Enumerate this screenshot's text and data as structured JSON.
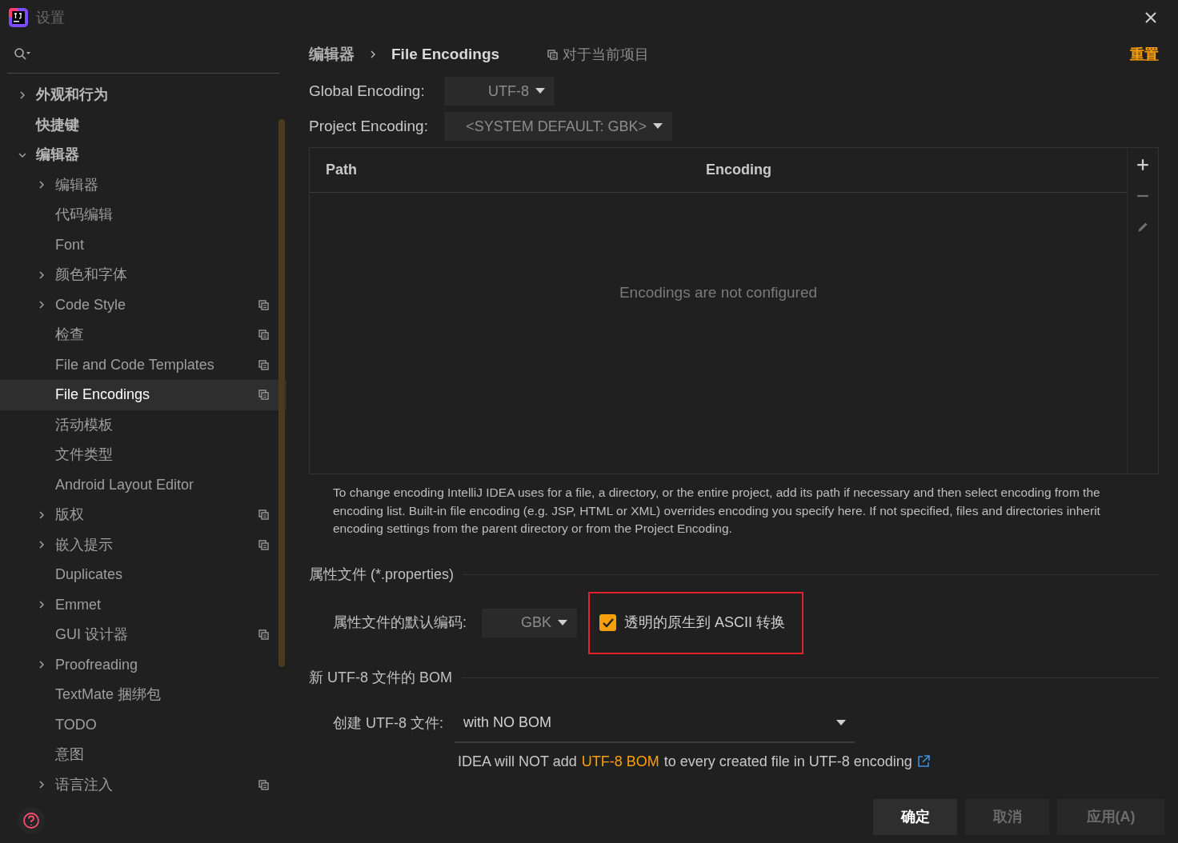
{
  "window": {
    "title": "设置"
  },
  "tree": [
    {
      "label": "外观和行为",
      "kind": "folder",
      "expanded": false,
      "selected": false,
      "project": false
    },
    {
      "label": "快捷键",
      "kind": "leaf",
      "selected": false,
      "project": false
    },
    {
      "label": "编辑器",
      "kind": "folder",
      "expanded": true,
      "selected": false,
      "project": false,
      "children": [
        {
          "label": "编辑器",
          "kind": "folder",
          "expanded": false,
          "selected": false,
          "project": false
        },
        {
          "label": "代码编辑",
          "kind": "leaf",
          "selected": false,
          "project": false
        },
        {
          "label": "Font",
          "kind": "leaf",
          "selected": false,
          "project": false
        },
        {
          "label": "颜色和字体",
          "kind": "folder",
          "expanded": false,
          "selected": false,
          "project": false
        },
        {
          "label": "Code Style",
          "kind": "folder",
          "expanded": false,
          "selected": false,
          "project": true
        },
        {
          "label": "检查",
          "kind": "leaf",
          "selected": false,
          "project": true
        },
        {
          "label": "File and Code Templates",
          "kind": "leaf",
          "selected": false,
          "project": true
        },
        {
          "label": "File Encodings",
          "kind": "leaf",
          "selected": true,
          "project": true
        },
        {
          "label": "活动模板",
          "kind": "leaf",
          "selected": false,
          "project": false
        },
        {
          "label": "文件类型",
          "kind": "leaf",
          "selected": false,
          "project": false
        },
        {
          "label": "Android Layout Editor",
          "kind": "leaf",
          "selected": false,
          "project": false
        },
        {
          "label": "版权",
          "kind": "folder",
          "expanded": false,
          "selected": false,
          "project": true
        },
        {
          "label": "嵌入提示",
          "kind": "folder",
          "expanded": false,
          "selected": false,
          "project": true
        },
        {
          "label": "Duplicates",
          "kind": "leaf",
          "selected": false,
          "project": false
        },
        {
          "label": "Emmet",
          "kind": "folder",
          "expanded": false,
          "selected": false,
          "project": false
        },
        {
          "label": "GUI 设计器",
          "kind": "leaf",
          "selected": false,
          "project": true
        },
        {
          "label": "Proofreading",
          "kind": "folder",
          "expanded": false,
          "selected": false,
          "project": false
        },
        {
          "label": "TextMate 捆绑包",
          "kind": "leaf",
          "selected": false,
          "project": false
        },
        {
          "label": "TODO",
          "kind": "leaf",
          "selected": false,
          "project": false
        },
        {
          "label": "意图",
          "kind": "leaf",
          "selected": false,
          "project": false
        },
        {
          "label": "语言注入",
          "kind": "folder",
          "expanded": false,
          "selected": false,
          "project": true
        }
      ]
    }
  ],
  "breadcrumb": [
    "编辑器",
    "File Encodings"
  ],
  "scope": "对于当前项目",
  "reset": "重置",
  "encodings": [
    {
      "label": "Global Encoding:",
      "value": "UTF-8"
    },
    {
      "label": "Project Encoding:",
      "value": "<SYSTEM DEFAULT: GBK>"
    }
  ],
  "table": {
    "columns": [
      "Path",
      "Encoding"
    ],
    "empty_text": "Encodings are not configured",
    "tools": [
      {
        "kind": "add",
        "disabled": false
      },
      {
        "kind": "remove",
        "disabled": true
      },
      {
        "kind": "edit",
        "disabled": true
      }
    ]
  },
  "description": "To change encoding IntelliJ IDEA uses for a file, a directory, or the entire project, add its path if necessary and then select encoding from the encoding list. Built-in file encoding (e.g. JSP, HTML or XML) overrides encoding you specify here. If not specified, files and directories inherit encoding settings from the parent directory or from the Project Encoding.",
  "properties": {
    "title": "属性文件 (*.properties)",
    "label": "属性文件的默认编码:",
    "value": "GBK",
    "checkbox": {
      "label": "透明的原生到 ASCII 转换",
      "checked": true,
      "highlighted": true
    }
  },
  "bom": {
    "title": "新 UTF-8 文件的 BOM",
    "label": "创建 UTF-8 文件:",
    "value": "with NO BOM",
    "hint_before": "IDEA will NOT add",
    "hint_highlight": "UTF-8 BOM",
    "hint_after": "to every created file in UTF-8 encoding"
  },
  "buttons": [
    {
      "label": "确定",
      "primary": true
    },
    {
      "label": "取消",
      "primary": false
    },
    {
      "label": "应用(A)",
      "primary": false
    }
  ]
}
